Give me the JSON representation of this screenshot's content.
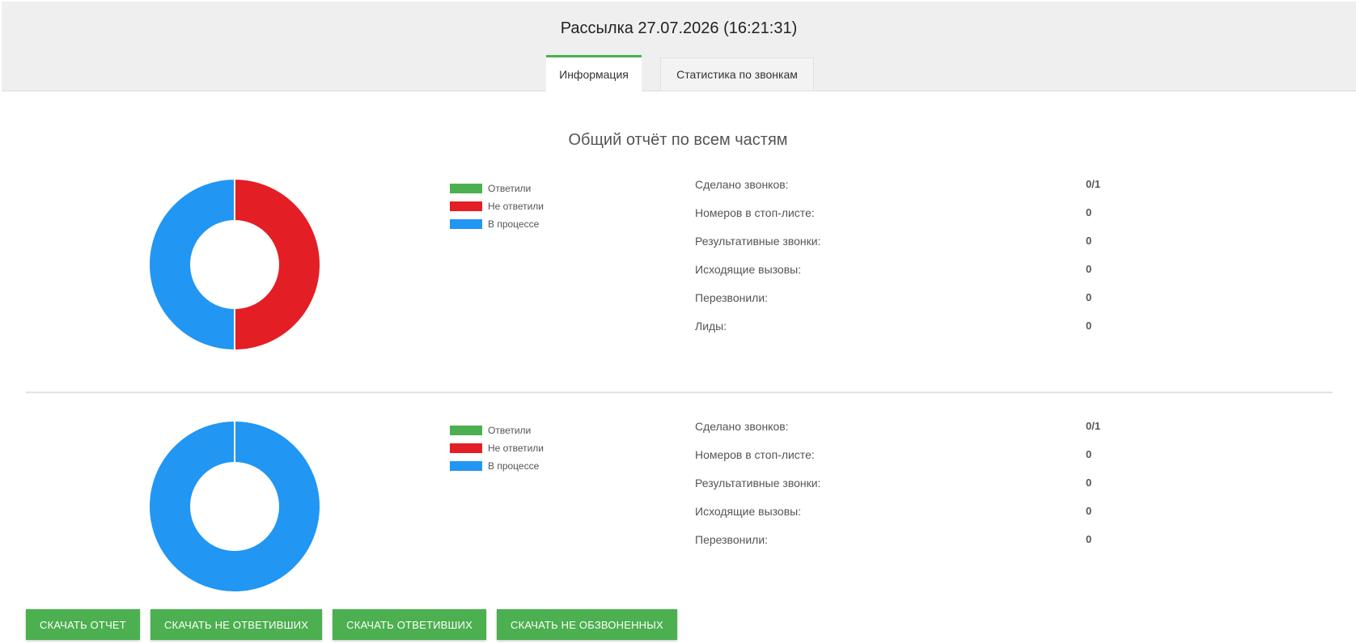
{
  "header": {
    "title": "Рассылка 27.07.2026 (16:21:31)",
    "tabs": [
      {
        "label": "Информация",
        "active": true
      },
      {
        "label": "Статистика по звонкам",
        "active": false
      }
    ]
  },
  "report": {
    "title": "Общий отчёт по всем частям"
  },
  "colors": {
    "answered": "#4caf50",
    "not_answered": "#e31e25",
    "in_progress": "#2196f3",
    "accent": "#4caf50"
  },
  "legend": [
    "Ответили",
    "Не ответили",
    "В процессе"
  ],
  "panels": [
    {
      "chart_data": {
        "type": "pie",
        "categories": [
          "Ответили",
          "Не ответили",
          "В процессе"
        ],
        "values": [
          0,
          50,
          50
        ]
      },
      "stats": [
        {
          "label": "Сделано звонков:",
          "value": "0/1"
        },
        {
          "label": "Номеров в стоп-листе:",
          "value": "0"
        },
        {
          "label": "Результативные звонки:",
          "value": "0"
        },
        {
          "label": "Исходящие вызовы:",
          "value": "0"
        },
        {
          "label": "Перезвонили:",
          "value": "0"
        },
        {
          "label": "Лиды:",
          "value": "0"
        }
      ]
    },
    {
      "chart_data": {
        "type": "pie",
        "categories": [
          "Ответили",
          "Не ответили",
          "В процессе"
        ],
        "values": [
          0,
          0,
          100
        ]
      },
      "stats": [
        {
          "label": "Сделано звонков:",
          "value": "0/1"
        },
        {
          "label": "Номеров в стоп-листе:",
          "value": "0"
        },
        {
          "label": "Результативные звонки:",
          "value": "0"
        },
        {
          "label": "Исходящие вызовы:",
          "value": "0"
        },
        {
          "label": "Перезвонили:",
          "value": "0"
        }
      ]
    }
  ],
  "buttons": [
    "СКАЧАТЬ ОТЧЕТ",
    "СКАЧАТЬ НЕ ОТВЕТИВШИХ",
    "СКАЧАТЬ ОТВЕТИВШИХ",
    "СКАЧАТЬ НЕ ОБЗВОНЕННЫХ"
  ]
}
